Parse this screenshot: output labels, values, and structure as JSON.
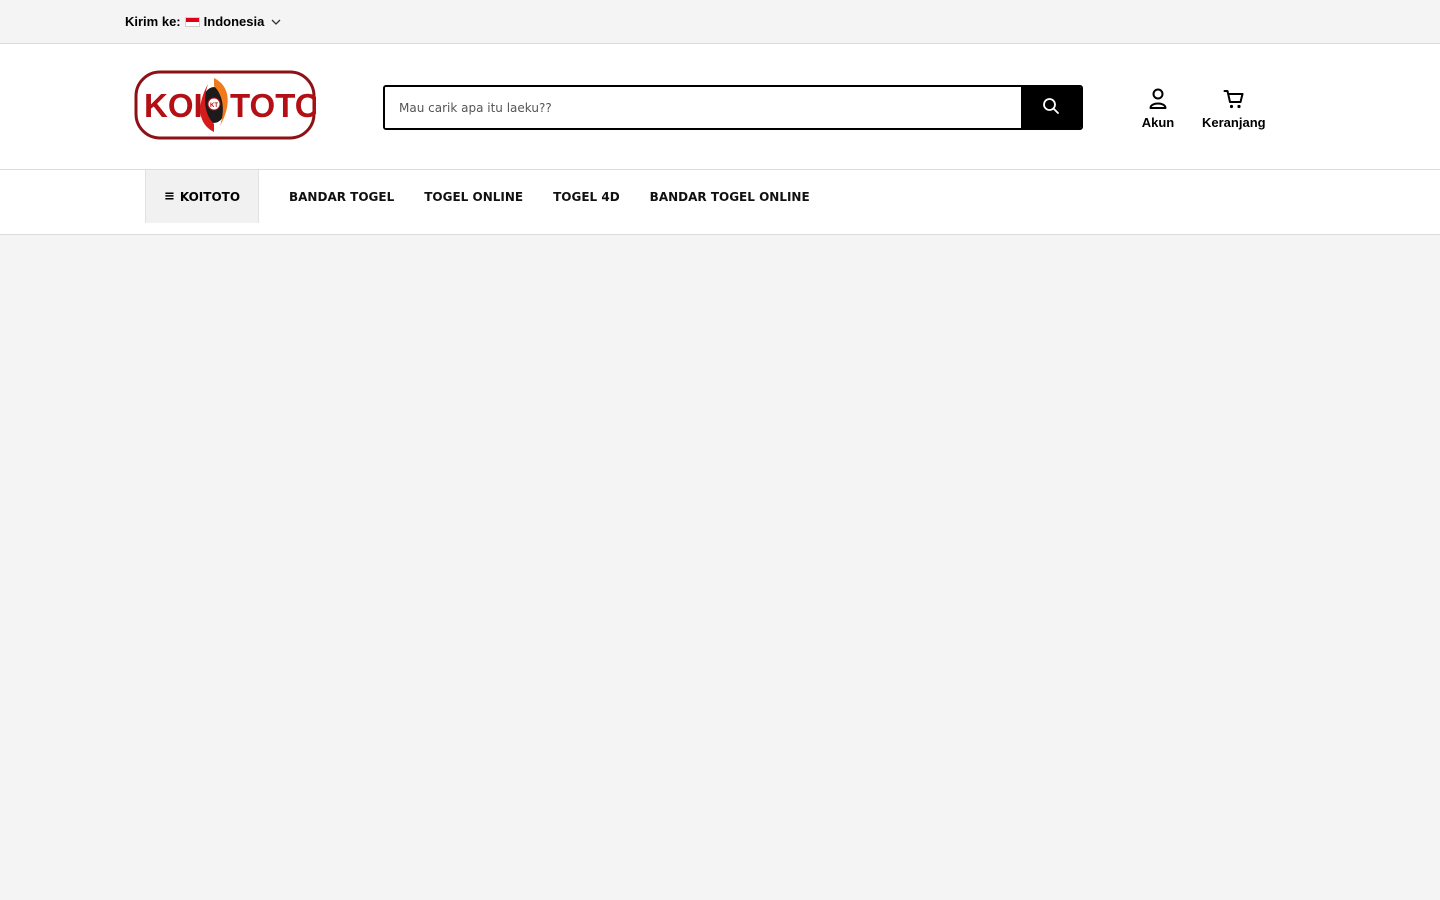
{
  "topbar": {
    "ship_label": "Kirim ke:",
    "country": "Indonesia"
  },
  "header": {
    "logo_text_left": "KOI",
    "logo_badge": "KT",
    "logo_text_right": "TOTO",
    "search": {
      "placeholder": "Mau carik apa itu laeku??",
      "value": ""
    },
    "account_label": "Akun",
    "cart_label": "Keranjang"
  },
  "nav": {
    "menu_label": "KOITOTO",
    "links": [
      "BANDAR TOGEL",
      "TOGEL ONLINE",
      "TOGEL 4D",
      "BANDAR TOGEL ONLINE"
    ]
  },
  "colors": {
    "logo_red": "#b30f14",
    "logo_orange": "#f07a1c",
    "accent_black": "#000000",
    "page_bg": "#f4f4f4"
  },
  "icons": [
    "chevron-down-icon",
    "search-icon",
    "user-icon",
    "cart-icon",
    "hamburger-icon"
  ]
}
